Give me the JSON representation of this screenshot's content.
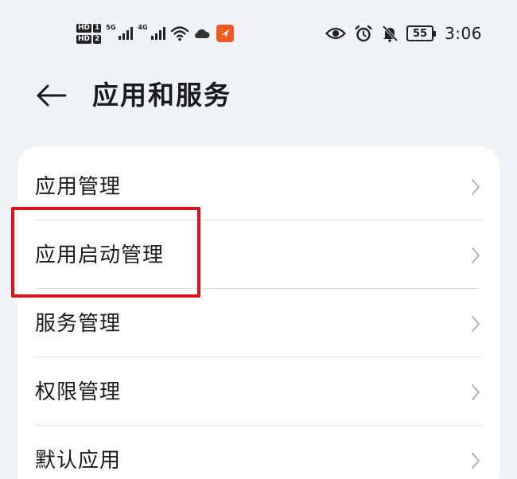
{
  "status_bar": {
    "sim1": {
      "hd": "HD",
      "slot": "1"
    },
    "sim2": {
      "hd": "HD",
      "slot": "2"
    },
    "network1": "5G",
    "network2": "4G",
    "icons": [
      "signal-icon",
      "signal-icon",
      "wifi-icon",
      "cloud-icon",
      "app-notification-icon",
      "eye-icon",
      "alarm-icon",
      "mute-bell-icon",
      "battery-icon"
    ],
    "battery": "55",
    "time": "3:06"
  },
  "header": {
    "title": "应用和服务"
  },
  "menu": {
    "items": [
      {
        "label": "应用管理"
      },
      {
        "label": "应用启动管理"
      },
      {
        "label": "服务管理"
      },
      {
        "label": "权限管理"
      },
      {
        "label": "默认应用"
      }
    ]
  },
  "colors": {
    "background": "#f1f2f6",
    "card": "#ffffff",
    "highlight": "#d7141c",
    "notification_app": "#f05a22"
  }
}
